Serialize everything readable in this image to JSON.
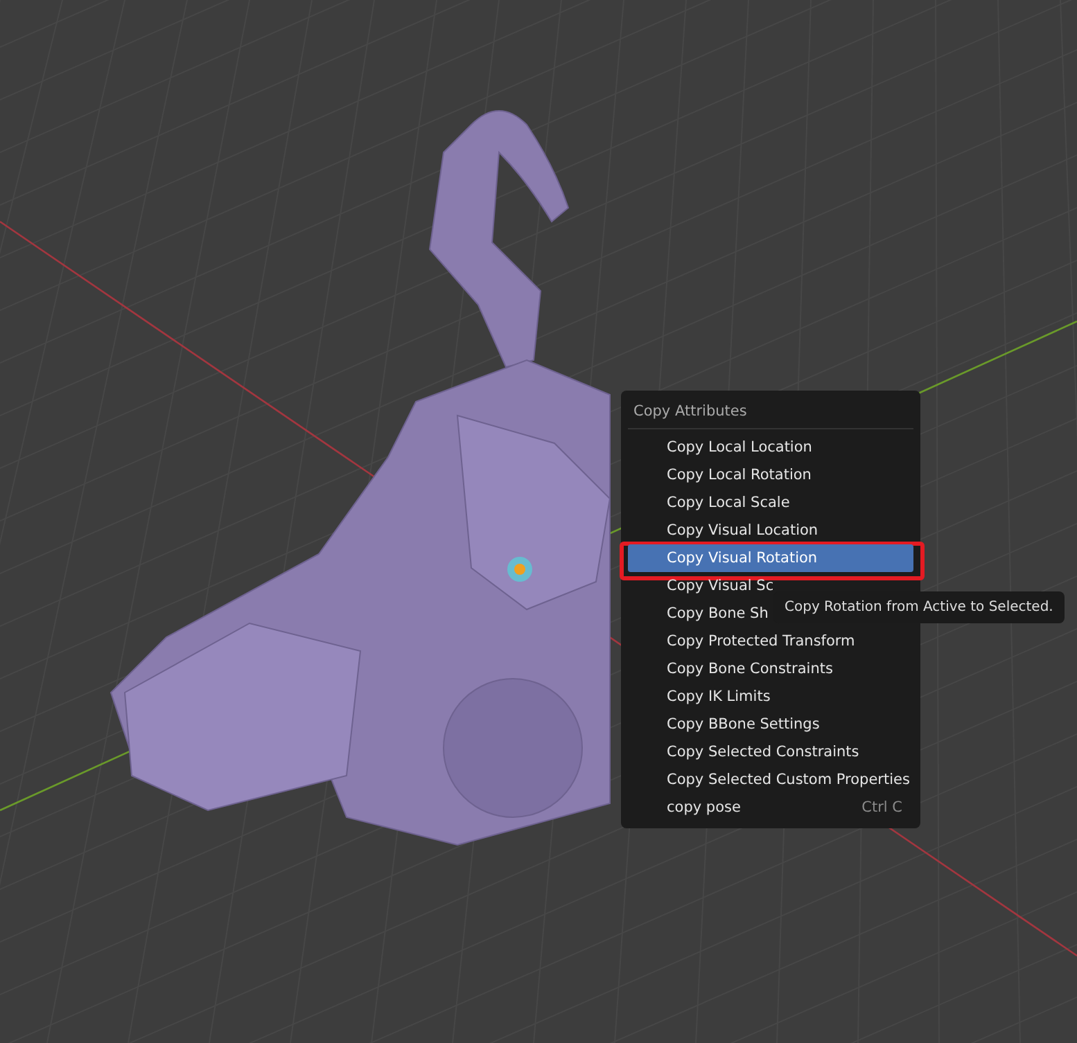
{
  "menu": {
    "title": "Copy Attributes",
    "items": [
      {
        "label": "Copy Local Location",
        "selected": false
      },
      {
        "label": "Copy Local Rotation",
        "selected": false
      },
      {
        "label": "Copy Local Scale",
        "selected": false
      },
      {
        "label": "Copy Visual Location",
        "selected": false
      },
      {
        "label": "Copy Visual Rotation",
        "selected": true
      },
      {
        "label": "Copy Visual Sc",
        "selected": false
      },
      {
        "label": "Copy Bone Sh",
        "selected": false
      },
      {
        "label": "Copy Protected Transform",
        "selected": false
      },
      {
        "label": "Copy Bone Constraints",
        "selected": false
      },
      {
        "label": "Copy IK Limits",
        "selected": false
      },
      {
        "label": "Copy BBone Settings",
        "selected": false
      },
      {
        "label": "Copy Selected Constraints",
        "selected": false
      },
      {
        "label": "Copy Selected Custom Properties",
        "selected": false
      },
      {
        "label": "copy pose",
        "selected": false,
        "shortcut": "Ctrl C"
      }
    ]
  },
  "tooltip": {
    "text": "Copy Rotation from Active to Selected."
  }
}
